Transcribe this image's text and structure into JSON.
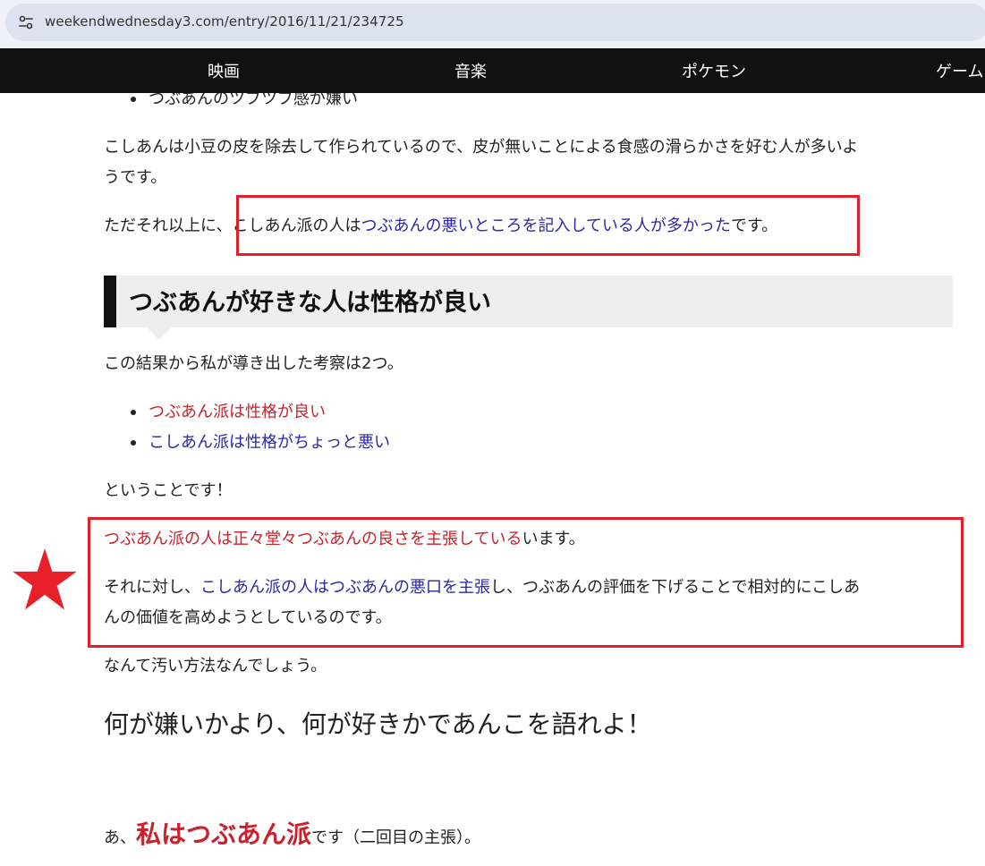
{
  "browser": {
    "url": "weekendwednesday3.com/entry/2016/11/21/234725",
    "site_info_icon": "tune-icon"
  },
  "nav": {
    "items": [
      "映画",
      "音楽",
      "ポケモン",
      "ゲーム"
    ]
  },
  "article": {
    "bullet_top": "つぶあんのツブツブ感が嫌い",
    "para1_line1": "こしあんは小豆の皮を除去して作られているので、皮が無いことによる食感の滑らかさを好む人が多いよ",
    "para1_line2": "うです。",
    "para2_prefix": "ただそれ以上に、",
    "para2_plain": "こしあん派の人は",
    "para2_link": "つぶあんの悪いところを記入している人が多かった",
    "para2_suffix": "です。",
    "heading": "つぶあんが好きな人は性格が良い",
    "para3": "この結果から私が導き出した考察は2つ。",
    "list": [
      {
        "text": "つぶあん派は性格が良い",
        "color": "#c8232c"
      },
      {
        "text": "こしあん派は性格がちょっと悪い",
        "color": "#2b27a8"
      }
    ],
    "para4": "ということです！",
    "box_line1_red": "つぶあん派の人は正々堂々つぶあんの良さを主張している",
    "box_line1_suffix": "います。",
    "box_line2_prefix": "それに対し、",
    "box_line2_blue": "こしあん派の人はつぶあんの悪口を主張",
    "box_line2_suffix": "し、つぶあんの評価を下げることで相対的にこしあ",
    "box_line3": "んの価値を高めようとしているのです。",
    "para5": "なんて汚い方法なんでしょう。",
    "big_heading": "何が嫌いかより、何が好きかであんこを語れよ！",
    "final_prefix": "あ、",
    "final_bold": "私はつぶあん派",
    "final_suffix": "です（二回目の主張）。"
  },
  "colors": {
    "highlight_box": "#e0202a",
    "red_text": "#c8232c",
    "blue_text": "#2b27a8",
    "star": "#e8202a",
    "nav_bg": "#111111"
  },
  "annotation": {
    "star_icon": "star-icon"
  }
}
